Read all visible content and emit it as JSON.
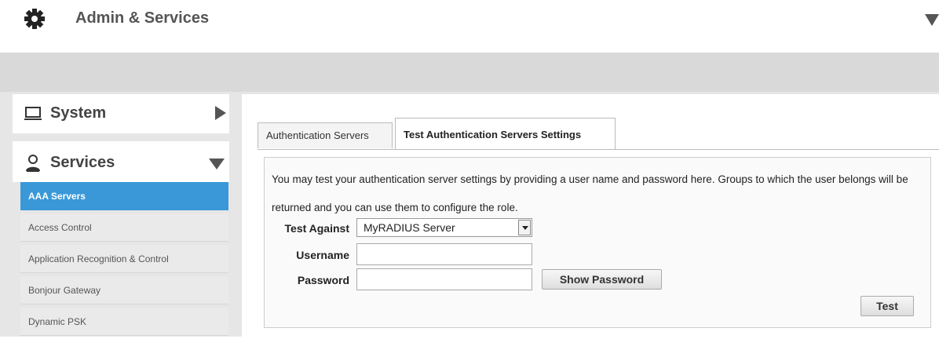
{
  "header": {
    "title": "Admin & Services",
    "icon": "gear-icon"
  },
  "sidebar": {
    "sections": [
      {
        "label": "System",
        "icon": "monitor-icon",
        "expanded": false
      },
      {
        "label": "Services",
        "icon": "services-icon",
        "expanded": true
      }
    ],
    "items": [
      {
        "label": "AAA Servers",
        "active": true
      },
      {
        "label": "Access Control",
        "active": false
      },
      {
        "label": "Application Recognition & Control",
        "active": false
      },
      {
        "label": "Bonjour Gateway",
        "active": false
      },
      {
        "label": "Dynamic PSK",
        "active": false
      }
    ]
  },
  "tabs": [
    {
      "label": "Authentication Servers",
      "active": false
    },
    {
      "label": "Test Authentication Servers Settings",
      "active": true
    }
  ],
  "form": {
    "description": "You may test your authentication server settings by providing a user name and password here. Groups to which the user belongs will be returned and you can use them to configure the role.",
    "test_against_label": "Test Against",
    "test_against_value": "MyRADIUS Server",
    "username_label": "Username",
    "username_value": "",
    "password_label": "Password",
    "password_value": "",
    "show_password_label": "Show Password",
    "test_label": "Test"
  },
  "colors": {
    "accent": "#3a98d8",
    "band": "#d9d9d9",
    "page_bg": "#e6e6e6"
  }
}
